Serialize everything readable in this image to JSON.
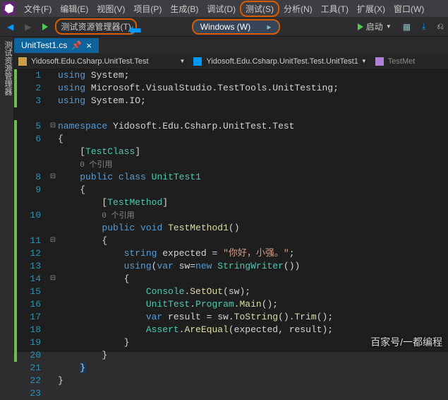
{
  "menu": {
    "file": "文件(F)",
    "edit": "编辑(E)",
    "view": "视图(V)",
    "project": "项目(P)",
    "build": "生成(B)",
    "debug": "调试(D)",
    "test": "测试(S)",
    "analyze": "分析(N)",
    "tools": "工具(T)",
    "extensions": "扩展(X)",
    "window": "窗口(W)"
  },
  "toolbar": {
    "test_explorer": "测试资源管理器(T)",
    "windows": "Windows (W)",
    "start": "启动"
  },
  "sidebar": {
    "label": "测试资源管理器"
  },
  "tab": {
    "name": "UnitTest1.cs"
  },
  "breadcrumb": {
    "project": "Yidosoft.Edu.Csharp.UnitTest.Test",
    "namespace": "Yidosoft.Edu.Csharp.UnitTest.Test.UnitTest1",
    "method": "TestMet"
  },
  "code": {
    "lines": [
      {
        "n": "1"
      },
      {
        "n": "2"
      },
      {
        "n": "3"
      },
      {
        "n": ""
      },
      {
        "n": "5"
      },
      {
        "n": "6"
      },
      {
        "n": ""
      },
      {
        "n": ""
      },
      {
        "n": "8"
      },
      {
        "n": "9"
      },
      {
        "n": ""
      },
      {
        "n": "10"
      },
      {
        "n": ""
      },
      {
        "n": "11"
      },
      {
        "n": "12"
      },
      {
        "n": "13"
      },
      {
        "n": "14"
      },
      {
        "n": "15"
      },
      {
        "n": "16"
      },
      {
        "n": "17"
      },
      {
        "n": "18"
      },
      {
        "n": "19"
      },
      {
        "n": "20"
      },
      {
        "n": "21"
      },
      {
        "n": "22"
      },
      {
        "n": "23"
      }
    ],
    "using_system": "System",
    "using_mstest": "Microsoft.VisualStudio.TestTools.UnitTesting",
    "using_io": "System.IO",
    "namespace": "Yidosoft.Edu.Csharp.UnitTest.Test",
    "testclass_attr": "TestClass",
    "refs": "0 个引用",
    "class_name": "UnitTest1",
    "testmethod_attr": "TestMethod",
    "method_name": "TestMethod1",
    "expected_str": "\"你好，小强。\"",
    "stringwriter": "StringWriter",
    "console_setout": "Console",
    "setout": "SetOut",
    "unittest": "UnitTest",
    "program": "Program",
    "main": "Main",
    "sw": "sw",
    "tostring": "ToString",
    "trim": "Trim",
    "assert": "Assert",
    "areequal": "AreEqual",
    "expected": "expected",
    "result": "result"
  },
  "watermark": "百家号/一都编程"
}
